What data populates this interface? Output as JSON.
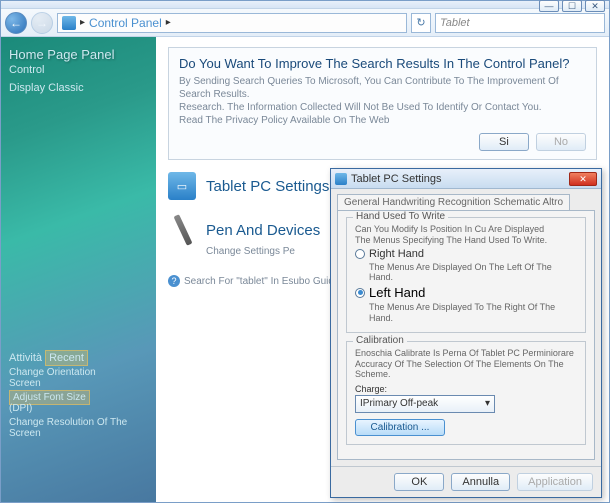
{
  "window": {
    "minimize": "—",
    "maximize": "☐",
    "close": "✕"
  },
  "nav": {
    "back_arrow": "←",
    "fwd_arrow": "→",
    "breadcrumb_sep": "▸",
    "breadcrumb": "Control Panel",
    "breadcrumb_sep2": "▸",
    "refresh": "↻",
    "search_placeholder": "Tablet"
  },
  "sidebar": {
    "header1": "Home Page Panel",
    "header2": "Control",
    "classic": "Display Classic",
    "activity_label": "Attività",
    "activity_recent": "Recent",
    "link1a": "Change Orientation",
    "link1b": "Screen",
    "link2a": "Adjust Font Size",
    "link2b": "(DPI)",
    "link3a": "Change Resolution Of The",
    "link3b": "Screen"
  },
  "content": {
    "info_title": "Do You Want To Improve The Search Results In The Control Panel?",
    "info_line1": "By Sending Search Queries To Microsoft, You Can Contribute To The Improvement Of Search Results.",
    "info_line2": "Research. The Information Collected Will Not Be Used To Identify Or Contact You.",
    "info_line3": "Read The Privacy Policy Available On The Web",
    "btn_yes": "Si",
    "btn_no": "No",
    "sec1_title": "Tablet PC Settings",
    "sec2_title": "Pen And Devices",
    "sec2_sub": "Change Settings Pe",
    "help_text": "Search For \"tablet\" In Esubo Guide"
  },
  "dialog": {
    "title": "Tablet PC Settings",
    "tab": "General Handwriting Recognition Schematic Altro",
    "fs1_legend": "Hand Used To Write",
    "fs1_text1": "Can You Modify Is Position In Cu Are Displayed",
    "fs1_text2": "The Menus Specifying The Hand Used To Write.",
    "radio1": "Right Hand",
    "radio1_sub": "The Menus Are Displayed On The Left Of The Hand.",
    "radio2": "Left Hand",
    "radio2_sub": "The Menus Are Displayed To The Right Of The Hand.",
    "fs2_legend": "Calibration",
    "fs2_text1": "Enoschia Calibrate Is Perna Of Tablet PC Perminiorare",
    "fs2_text2": "Accuracy Of The Selection Of The Elements On The Scheme.",
    "charge_label": "Charge:",
    "dropdown": "IPrimary Off-peak",
    "calib_btn": "Calibration ...",
    "ok": "OK",
    "cancel": "Annulla",
    "apply": "Application"
  }
}
